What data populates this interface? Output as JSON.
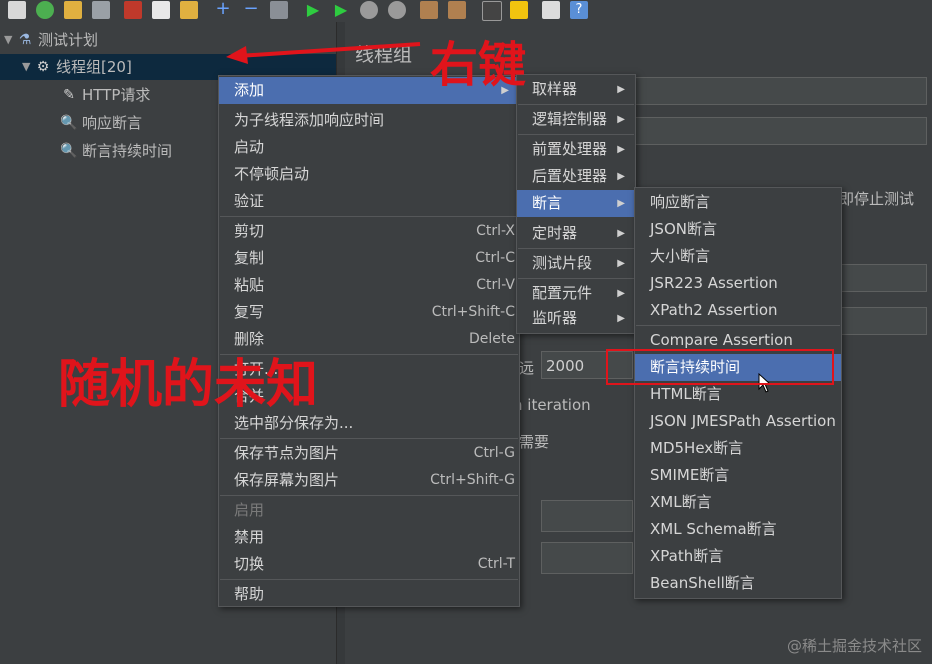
{
  "tree": {
    "items": [
      {
        "label": "测试计划"
      },
      {
        "label": "线程组[20]"
      },
      {
        "label": "HTTP请求"
      },
      {
        "label": "响应断言"
      },
      {
        "label": "断言持续时间"
      }
    ]
  },
  "right_panel": {
    "title": "线程组",
    "stop_text": "即停止测试",
    "delay_label": "远",
    "delay_value": "2000",
    "iteration_text": "n iteration",
    "need_text": "需要"
  },
  "context_menu": {
    "items": [
      {
        "label": "添加",
        "submenu": true
      },
      {
        "label": "为子线程添加响应时间"
      },
      {
        "label": "启动"
      },
      {
        "label": "不停顿启动"
      },
      {
        "label": "验证"
      },
      {
        "label": "剪切",
        "shortcut": "Ctrl-X"
      },
      {
        "label": "复制",
        "shortcut": "Ctrl-C"
      },
      {
        "label": "粘贴",
        "shortcut": "Ctrl-V"
      },
      {
        "label": "复写",
        "shortcut": "Ctrl+Shift-C"
      },
      {
        "label": "删除",
        "shortcut": "Delete"
      },
      {
        "label": "打开..."
      },
      {
        "label": "合并"
      },
      {
        "label": "选中部分保存为..."
      },
      {
        "label": "保存节点为图片",
        "shortcut": "Ctrl-G"
      },
      {
        "label": "保存屏幕为图片",
        "shortcut": "Ctrl+Shift-G"
      },
      {
        "label": "启用"
      },
      {
        "label": "禁用"
      },
      {
        "label": "切换",
        "shortcut": "Ctrl-T"
      },
      {
        "label": "帮助"
      }
    ]
  },
  "add_submenu": {
    "items": [
      {
        "label": "取样器"
      },
      {
        "label": "逻辑控制器"
      },
      {
        "label": "前置处理器"
      },
      {
        "label": "后置处理器"
      },
      {
        "label": "断言"
      },
      {
        "label": "定时器"
      },
      {
        "label": "测试片段"
      },
      {
        "label": "配置元件"
      },
      {
        "label": "监听器"
      }
    ]
  },
  "assertion_submenu": {
    "items": [
      {
        "label": "响应断言"
      },
      {
        "label": "JSON断言"
      },
      {
        "label": "大小断言"
      },
      {
        "label": "JSR223 Assertion"
      },
      {
        "label": "XPath2 Assertion"
      },
      {
        "label": "Compare Assertion"
      },
      {
        "label": "断言持续时间"
      },
      {
        "label": "HTML断言"
      },
      {
        "label": "JSON JMESPath Assertion"
      },
      {
        "label": "MD5Hex断言"
      },
      {
        "label": "SMIME断言"
      },
      {
        "label": "XML断言"
      },
      {
        "label": "XML Schema断言"
      },
      {
        "label": "XPath断言"
      },
      {
        "label": "BeanShell断言"
      }
    ]
  },
  "annotations": {
    "right_click": "右键",
    "random_unknown": "随机的未知"
  },
  "watermark": "@稀土掘金技术社区",
  "colors": {
    "background": "#3c3f41",
    "selection": "#4b6eaf",
    "annotation_red": "#e0141b"
  }
}
